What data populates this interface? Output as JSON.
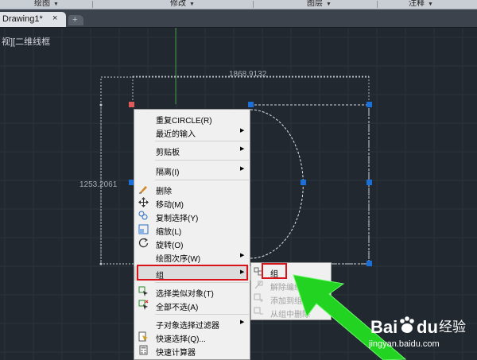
{
  "menubar": {
    "items": [
      "绘图",
      "修改",
      "图层",
      "注释"
    ]
  },
  "tabs": {
    "document": "Drawing1*",
    "close": "×",
    "new": "+"
  },
  "viewport": {
    "label": "视][二维线框"
  },
  "dimensions": {
    "width": "1868.9132",
    "height": "1253.2061"
  },
  "context_menu": {
    "repeat": "重复CIRCLE(R)",
    "recent": "最近的输入",
    "clipboard": "剪贴板",
    "isolate": "隔离(I)",
    "erase": "删除",
    "move": "移动(M)",
    "copy": "复制选择(Y)",
    "scale": "缩放(L)",
    "rotate": "旋转(O)",
    "draworder": "绘图次序(W)",
    "group": "组",
    "select_similar": "选择类似对象(T)",
    "deselect_all": "全部不选(A)",
    "subobject_filter": "子对象选择过滤器",
    "quick_select": "快速选择(Q)...",
    "quickcalc": "快速计算器"
  },
  "submenu": {
    "group": "组",
    "ungroup": "解除编组",
    "add_to_group": "添加到组",
    "remove_from_group": "从组中删除"
  },
  "watermark": {
    "brand_a": "Bai",
    "brand_b": "du",
    "brand_cn": "经验",
    "url": "jingyan.baidu.com"
  },
  "colors": {
    "canvas": "#212830",
    "highlight": "#d8141a",
    "arrow": "#23d321",
    "grip": "#1b6fd8",
    "grip_selected": "#e05a5a"
  }
}
